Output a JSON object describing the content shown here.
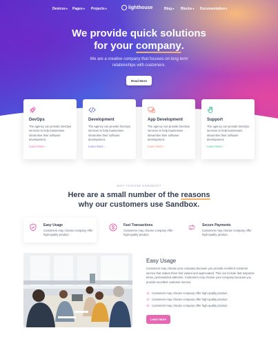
{
  "nav": {
    "left": [
      {
        "label": "Devices"
      },
      {
        "label": "Pages"
      },
      {
        "label": "Projects"
      }
    ],
    "right": [
      {
        "label": "Blog"
      },
      {
        "label": "Blocks"
      },
      {
        "label": "Documentation"
      }
    ],
    "brand": "lighthouse"
  },
  "hero": {
    "title_line1": "We provide quick solutions",
    "title_line2_pre": "for your ",
    "title_highlight": "company",
    "title_line2_post": ".",
    "subtitle": "We are a creative company that focuses on long term relationships with customers.",
    "button": "Read More"
  },
  "services": [
    {
      "title": "DevOps",
      "text": "The agency can provide DevOps services to help businesses streamline their software development.",
      "link": "Learn More",
      "color": "#e668b3",
      "icon": "rocket-icon"
    },
    {
      "title": "Development",
      "text": "The agency can provide DevOps services to help businesses streamline their software development.",
      "link": "Learn More",
      "color": "#747ed1",
      "icon": "code-icon"
    },
    {
      "title": "App Development",
      "text": "The agency can provide DevOps services to help businesses streamline their software development.",
      "link": "Learn More",
      "color": "#f78b77",
      "icon": "devices-icon"
    },
    {
      "title": "Support",
      "text": "The agency can provide DevOps services to help businesses streamline their software development.",
      "link": "Learn More",
      "color": "#45c4a0",
      "icon": "hand-icon"
    }
  ],
  "why": {
    "eyebrow": "WHY CHOOSE SANDBOX?",
    "title_pre": "Here are a small number of the ",
    "title_highlight": "reasons",
    "title_line2": "why our customers use Sandbox."
  },
  "features": [
    {
      "title": "Easy Usage",
      "text": "Customers may choose company offer high-quality product.",
      "icon": "shield-check-icon",
      "color": "#e668b3"
    },
    {
      "title": "Fast Transactions",
      "text": "Customers may choose company offer high-quality product.",
      "icon": "dollar-circle-icon",
      "color": "#e668b3"
    },
    {
      "title": "Secure Payments",
      "text": "Customers may choose company offer high-quality product.",
      "icon": "arrows-swap-icon",
      "color": "#e668b3"
    }
  ],
  "about": {
    "title": "Easy Usage",
    "text": "Customers may choose your company because you provide excellent customer service that makes them feel valued and appreciated. This can include fast response times, personalized attention. Customers may choose your company because you provide excellent customer service.",
    "checks": [
      "Customers may choose company offer high-quality product.",
      "Customers may choose company offer high-quality product.",
      "Customers may choose company offer high-quality product."
    ],
    "button": "Learn More",
    "accent": "#e668b3"
  }
}
